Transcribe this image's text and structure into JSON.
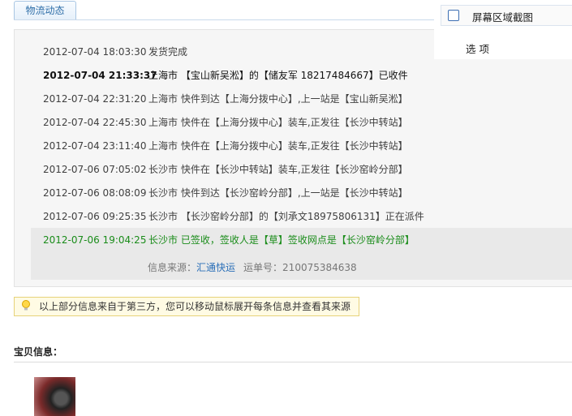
{
  "tab": {
    "label": "物流动态"
  },
  "events": [
    {
      "time": "2012-07-04 18:03:30",
      "desc": "发货完成"
    },
    {
      "time": "2012-07-04 21:33:37",
      "desc": "上海市 【宝山新吴淞】的【储友军 18217484667】已收件"
    },
    {
      "time": "2012-07-04 22:31:20",
      "desc": "上海市 快件到达【上海分拨中心】,上一站是【宝山新吴淞】"
    },
    {
      "time": "2012-07-04 22:45:30",
      "desc": "上海市 快件在【上海分拨中心】装车,正发往【长沙中转站】"
    },
    {
      "time": "2012-07-04 23:11:40",
      "desc": "上海市 快件在【上海分拨中心】装车,正发往【长沙中转站】"
    },
    {
      "time": "2012-07-06 07:05:02",
      "desc": "长沙市 快件在【长沙中转站】装车,正发往【长沙窑岭分部】"
    },
    {
      "time": "2012-07-06 08:08:09",
      "desc": "长沙市 快件到达【长沙窑岭分部】,上一站是【长沙中转站】"
    },
    {
      "time": "2012-07-06 09:25:35",
      "desc": "长沙市 【长沙窑岭分部】的【刘承文18975806131】正在派件"
    },
    {
      "time": "2012-07-06 19:04:25",
      "desc": "长沙市 已签收，签收人是【草】签收网点是【长沙窑岭分部】"
    }
  ],
  "source": {
    "label": "信息来源：",
    "company": "汇通快运",
    "waybill_label": "运单号：",
    "waybill": "210075384638"
  },
  "notice": {
    "text": "以上部分信息来自于第三方，您可以移动鼠标展开每条信息并查看其来源"
  },
  "section": {
    "title": "宝贝信息："
  },
  "context_menu": {
    "item1": "屏幕区域截图",
    "item2": "选 项"
  },
  "colors": {
    "final_status": "#1a8c1a",
    "link": "#2a6fb8",
    "tab_text": "#2e6ea8"
  }
}
